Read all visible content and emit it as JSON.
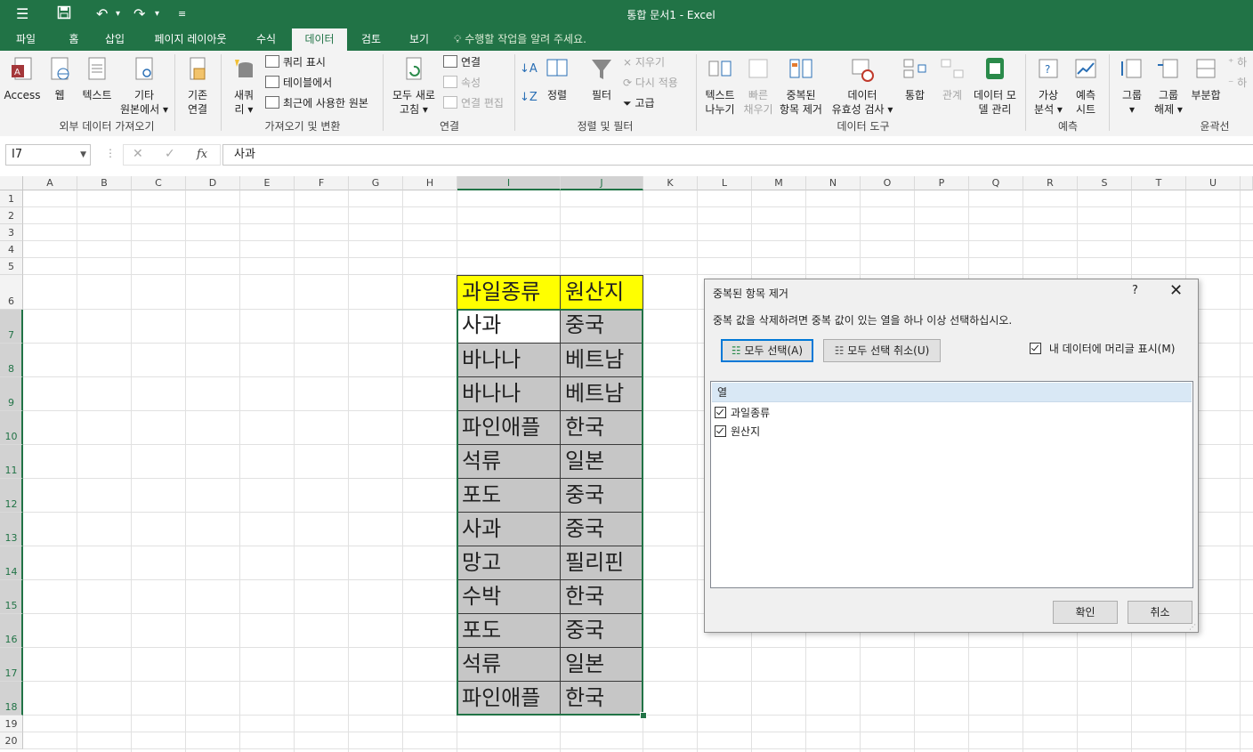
{
  "window": {
    "title": "통합 문서1 - Excel"
  },
  "tabs": [
    "파일",
    "홈",
    "삽입",
    "페이지 레이아웃",
    "수식",
    "데이터",
    "검토",
    "보기"
  ],
  "active_tab": "데이터",
  "tell_me": "수행할 작업을 알려 주세요.",
  "ribbon": {
    "ext": {
      "access": "Access",
      "web": "웹",
      "text": "텍스트",
      "other1": "기타",
      "other2": "원본에서 ▾",
      "group": "외부 데이터 가져오기"
    },
    "conn_existing": {
      "l1": "기존",
      "l2": "연결"
    },
    "gt": {
      "new1": "새쿼",
      "new2": "리 ▾",
      "show_query": "쿼리 표시",
      "from_table": "테이블에서",
      "recent": "최근에 사용한 원본",
      "group": "가져오기 및 변환"
    },
    "conn": {
      "refresh1": "모두 새로",
      "refresh2": "고침 ▾",
      "connections": "연결",
      "properties": "속성",
      "edit_links": "연결 편집",
      "group": "연결"
    },
    "sort": {
      "sort": "정렬",
      "filter": "필터",
      "clear": "지우기",
      "reapply": "다시 적용",
      "advanced": "고급",
      "group": "정렬 및 필터"
    },
    "tools": {
      "t2c1": "텍스트",
      "t2c2": "나누기",
      "flash1": "빠른",
      "flash2": "채우기",
      "dup1": "중복된",
      "dup2": "항목 제거",
      "val1": "데이터",
      "val2": "유효성 검사 ▾",
      "consolidate": "통합",
      "relations": "관계",
      "model1": "데이터 모",
      "model2": "델 관리",
      "group": "데이터 도구"
    },
    "forecast": {
      "whatif1": "가상",
      "whatif2": "분석 ▾",
      "sheet1": "예측",
      "sheet2": "시트",
      "group": "예측"
    },
    "outline": {
      "group_btn1": "그룹",
      "group_btn2": "▾",
      "ungroup1": "그룹",
      "ungroup2": "해제 ▾",
      "subtotal": "부분합",
      "group": "윤곽선"
    }
  },
  "formula_bar": {
    "name_box": "I7",
    "formula": "사과"
  },
  "columns": [
    "A",
    "B",
    "C",
    "D",
    "E",
    "F",
    "G",
    "H",
    "I",
    "J",
    "K",
    "L",
    "M",
    "N",
    "O",
    "P",
    "Q",
    "R",
    "S",
    "T",
    "U"
  ],
  "rows": [
    "1",
    "2",
    "3",
    "4",
    "5",
    "6",
    "7",
    "8",
    "9",
    "10",
    "11",
    "12",
    "13",
    "14",
    "15",
    "16",
    "17",
    "18",
    "19",
    "20"
  ],
  "table": {
    "headers": [
      "과일종류",
      "원산지"
    ],
    "rows": [
      [
        "사과",
        "중국"
      ],
      [
        "바나나",
        "베트남"
      ],
      [
        "바나나",
        "베트남"
      ],
      [
        "파인애플",
        "한국"
      ],
      [
        "석류",
        "일본"
      ],
      [
        "포도",
        "중국"
      ],
      [
        "사과",
        "중국"
      ],
      [
        "망고",
        "필리핀"
      ],
      [
        "수박",
        "한국"
      ],
      [
        "포도",
        "중국"
      ],
      [
        "석류",
        "일본"
      ],
      [
        "파인애플",
        "한국"
      ]
    ]
  },
  "dialog": {
    "title": "중복된 항목 제거",
    "help": "?",
    "close": "✕",
    "message": "중복 값을 삭제하려면 중복 값이 있는 열을 하나 이상 선택하십시오.",
    "select_all": "모두 선택(A)",
    "unselect_all": "모두 선택 취소(U)",
    "header_checkbox": "내 데이터에 머리글 표시(M)",
    "list_header": "열",
    "columns": [
      "과일종류",
      "원산지"
    ],
    "ok": "확인",
    "cancel": "취소"
  },
  "colors": {
    "excel_green": "#217346",
    "header_fill": "#ffff00",
    "data_fill": "#c6c6c6"
  }
}
